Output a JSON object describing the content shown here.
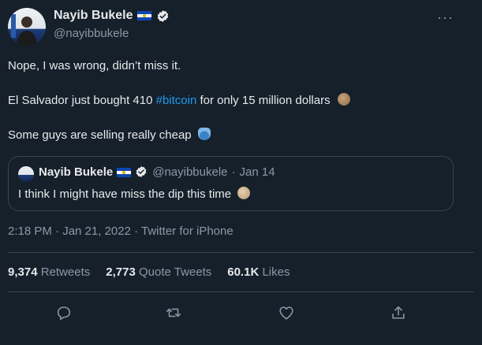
{
  "author": {
    "display_name": "Nayib Bukele",
    "handle": "@nayibbukele"
  },
  "tweet": {
    "line1": "Nope, I was wrong, didn’t miss it.",
    "line2_before": "El Salvador just bought 410 ",
    "line2_hashtag": "#bitcoin",
    "line2_after": " for only 15 million dollars",
    "line3": "Some guys are selling really cheap"
  },
  "quoted": {
    "display_name": "Nayib Bukele",
    "handle": "@nayibbukele",
    "separator": "·",
    "date": "Jan 14",
    "text": "I think I might have miss the dip this time"
  },
  "timestamp": "2:18 PM · Jan 21, 2022 · Twitter for iPhone",
  "stats": {
    "retweets_count": "9,374",
    "retweets_label": "Retweets",
    "quotes_count": "2,773",
    "quotes_label": "Quote Tweets",
    "likes_count": "60.1K",
    "likes_label": "Likes"
  },
  "more_glyph": "···",
  "colors": {
    "background": "#15202b",
    "text": "#e7e9ea",
    "muted": "#8b98a5",
    "link": "#1d9bf0",
    "border": "#38444d"
  },
  "icons": [
    "verified-badge-icon",
    "el-salvador-flag-icon",
    "reply-icon",
    "retweet-icon",
    "like-icon",
    "share-icon",
    "more-icon"
  ]
}
